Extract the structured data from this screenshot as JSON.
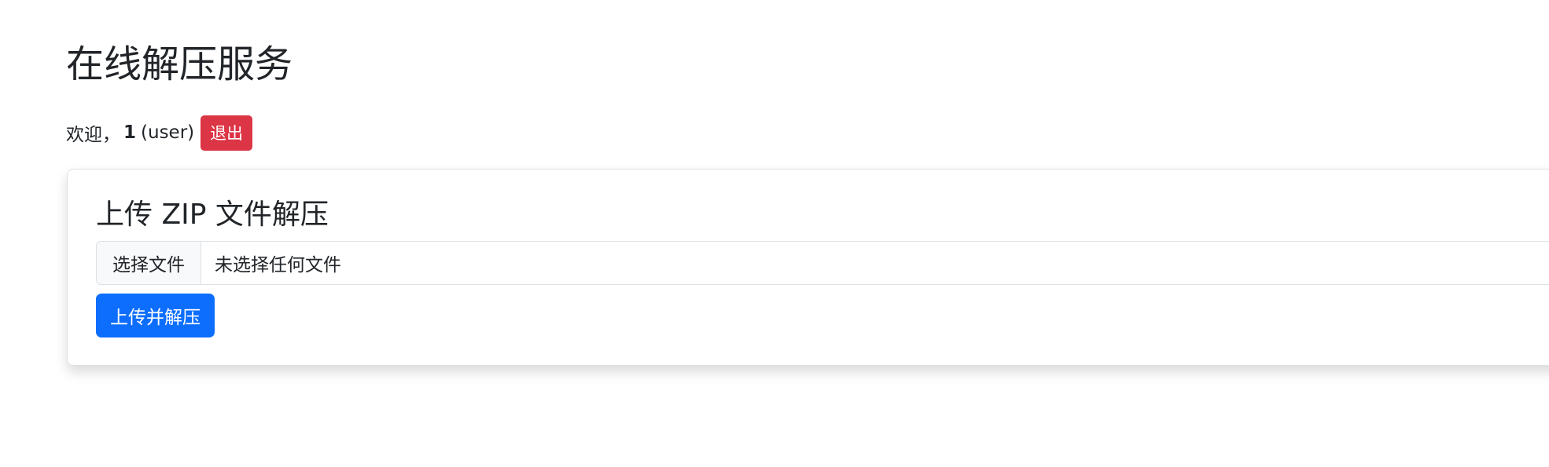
{
  "header": {
    "title": "在线解压服务"
  },
  "user": {
    "greeting": "欢迎，",
    "name": "1",
    "role": "(user)",
    "logout_label": "退出"
  },
  "upload_card": {
    "title": "上传 ZIP 文件解压",
    "file_input": {
      "choose_label": "选择文件",
      "status_text": "未选择任何文件"
    },
    "submit_label": "上传并解压"
  },
  "colors": {
    "primary": "#0d6efd",
    "danger": "#dc3545",
    "text": "#212529",
    "border": "#dee2e6",
    "input_button_bg": "#f8f9fa"
  }
}
